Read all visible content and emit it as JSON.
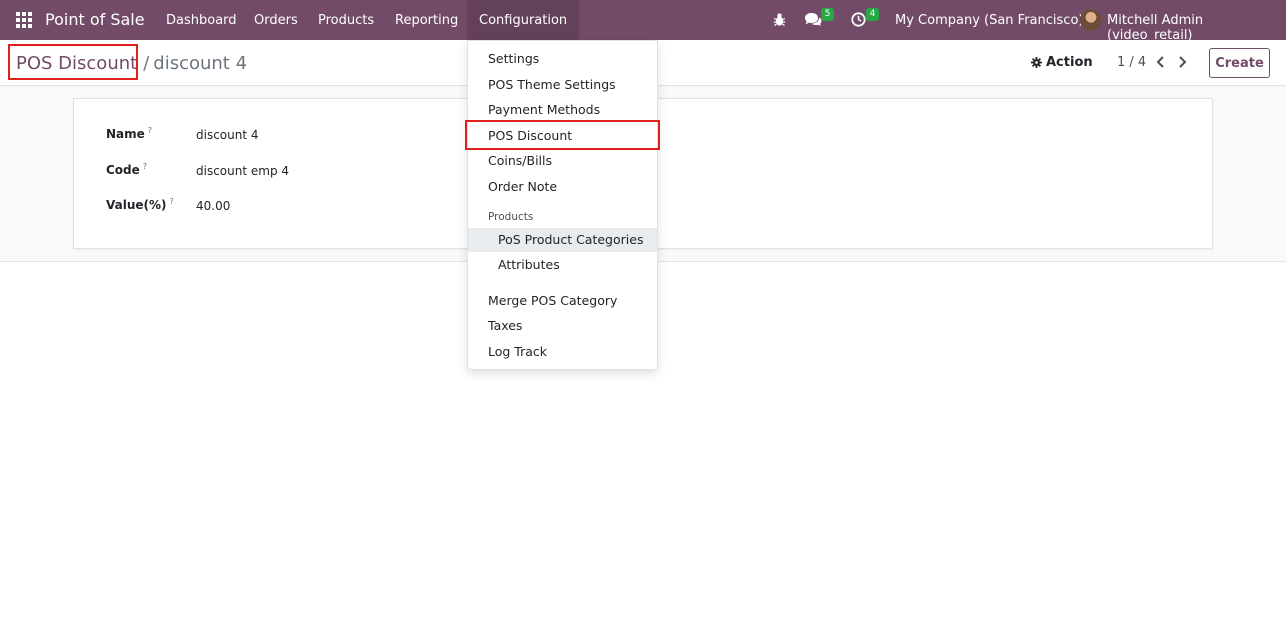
{
  "navbar": {
    "brand": "Point of Sale",
    "menu": [
      {
        "label": "Dashboard"
      },
      {
        "label": "Orders"
      },
      {
        "label": "Products"
      },
      {
        "label": "Reporting"
      },
      {
        "label": "Configuration"
      }
    ],
    "messages_badge": "5",
    "activities_badge": "4",
    "company": "My Company (San Francisco)",
    "user": "Mitchell Admin (video_retail)",
    "icons": [
      "apps-grid-icon",
      "bug-icon",
      "chat-icon",
      "clock-icon"
    ],
    "color": "#714b67"
  },
  "breadcrumb": {
    "parent": "POS Discount",
    "separator": "/",
    "current": "discount 4"
  },
  "control": {
    "action_label": "Action",
    "pager": "1 / 4",
    "create_label": "Create"
  },
  "form": {
    "fields": [
      {
        "label": "Name",
        "value": "discount 4"
      },
      {
        "label": "Code",
        "value": "discount emp 4"
      },
      {
        "label": "Value(%)",
        "value": "40.00"
      }
    ],
    "help_marker": "?"
  },
  "dropdown": {
    "items": [
      {
        "label": "Settings"
      },
      {
        "label": "POS Theme Settings"
      },
      {
        "label": "Payment Methods"
      },
      {
        "label": "POS Discount"
      },
      {
        "label": "Coins/Bills"
      },
      {
        "label": "Order Note"
      }
    ],
    "section_header": "Products",
    "sub_items": [
      {
        "label": "PoS Product Categories"
      },
      {
        "label": "Attributes"
      }
    ],
    "items_after": [
      {
        "label": "Merge POS Category"
      },
      {
        "label": "Taxes"
      },
      {
        "label": "Log Track"
      }
    ]
  },
  "highlight_color": "#e0201a"
}
